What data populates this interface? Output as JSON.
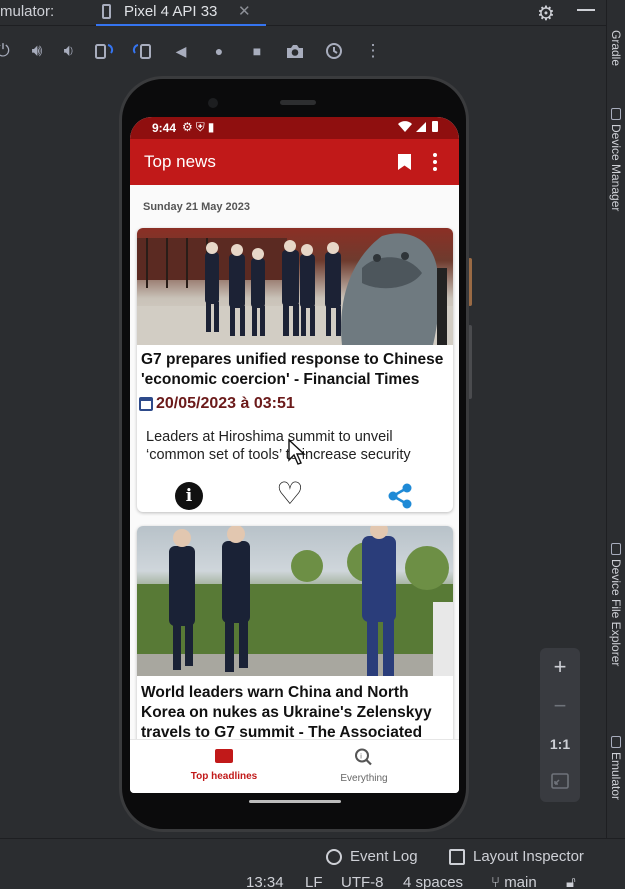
{
  "ide": {
    "panel_title": "mulator:",
    "device_tab": "Pixel 4 API 33",
    "tab_close": "✕",
    "toolbar_icons": [
      "power-icon",
      "volume-up-icon",
      "volume-down-icon",
      "rotate-left-icon",
      "rotate-right-icon",
      "back-icon",
      "home-icon",
      "overview-icon",
      "camera-icon",
      "snapshot-icon",
      "more-icon"
    ],
    "side_tools": [
      "Gradle",
      "Device Manager",
      "Device File Explorer",
      "Emulator"
    ],
    "zoom": {
      "zoom_in": "+",
      "zoom_out": "−",
      "actual_size": "1:1"
    },
    "bottom_tools": {
      "event_log": "Event Log",
      "layout_inspector": "Layout Inspector"
    },
    "status_bar": {
      "position": "13:34",
      "line_sep": "LF",
      "encoding": "UTF-8",
      "indent": "4 spaces",
      "branch": "main"
    }
  },
  "device": {
    "status": {
      "time": "9:44"
    },
    "app": {
      "title": "Top news",
      "date": "Sunday 21 May 2023",
      "articles": [
        {
          "title": "G7 prepares unified response to Chinese 'economic coercion' - Financial Times",
          "published": "20/05/2023 à 03:51",
          "description": "Leaders at Hiroshima summit to unveil ‘common set of tools’ to increase security"
        },
        {
          "title": "World leaders warn China and North Korea on nukes as Ukraine's Zelenskyy travels to G7 summit - The Associated"
        }
      ],
      "nav": [
        {
          "label": "Top headlines",
          "active": true
        },
        {
          "label": "Everything",
          "active": false
        }
      ]
    }
  },
  "colors": {
    "app_bar": "#c11919",
    "status_bar": "#8f0f0f",
    "date_text": "#6b1a1a",
    "share_icon": "#1f8ad6",
    "ide_accent": "#3574f0"
  }
}
